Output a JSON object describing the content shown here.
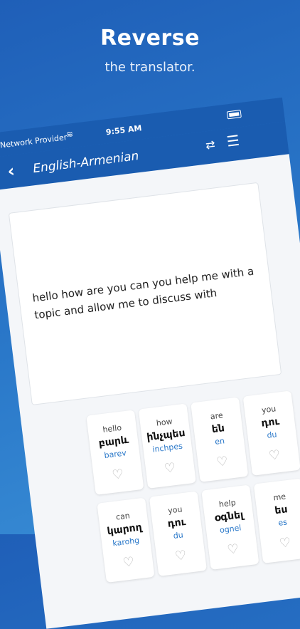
{
  "promo": {
    "title": "Reverse",
    "subtitle": "the translator."
  },
  "status_bar": {
    "carrier": "Network Provider",
    "time": "9:55 AM"
  },
  "nav": {
    "title": "English-Armenian"
  },
  "input": {
    "text": "hello how are you can you help me with a topic and allow me to discuss with"
  },
  "words": [
    {
      "en": "hello",
      "hy": "բարև",
      "tr": "barev"
    },
    {
      "en": "how",
      "hy": "ինչպես",
      "tr": "inchpes"
    },
    {
      "en": "are",
      "hy": "են",
      "tr": "en"
    },
    {
      "en": "you",
      "hy": "դու",
      "tr": "du"
    },
    {
      "en": "can",
      "hy": "կարող",
      "tr": "karohg"
    },
    {
      "en": "you",
      "hy": "դու",
      "tr": "du"
    },
    {
      "en": "help",
      "hy": "օգնել",
      "tr": "ognel"
    },
    {
      "en": "me",
      "hy": "ես",
      "tr": "es"
    }
  ],
  "colors": {
    "brand": "#1a5cb0",
    "accent": "#2a78c9"
  },
  "icons": [
    "wifi-icon",
    "battery-icon",
    "back-icon",
    "swap-icon",
    "menu-icon",
    "heart-icon"
  ]
}
